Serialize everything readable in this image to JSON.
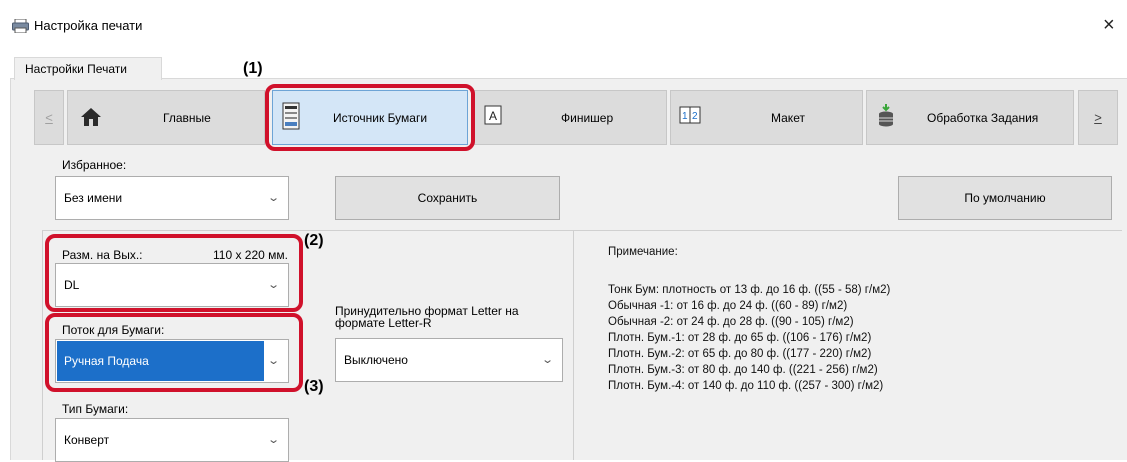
{
  "window": {
    "title": "Настройка печати",
    "close_glyph": "×"
  },
  "tab": {
    "label": "Настройки Печати"
  },
  "toolbar": {
    "prev": "<",
    "next": ">",
    "items": [
      {
        "label": "Главные",
        "icon": "home-icon"
      },
      {
        "label": "Источник Бумаги",
        "icon": "paper-tray-icon"
      },
      {
        "label": "Финишер",
        "icon": "finisher-icon"
      },
      {
        "label": "Макет",
        "icon": "layout-icon"
      },
      {
        "label": "Обработка Задания",
        "icon": "job-handling-icon"
      }
    ]
  },
  "favorites": {
    "label": "Избранное:",
    "value": "Без имени",
    "save_label": "Сохранить",
    "default_label": "По умолчанию"
  },
  "output_size": {
    "label": "Разм. на Вых.:",
    "dimensions": "110 x 220 мм.",
    "value": "DL"
  },
  "paper_tray": {
    "label": "Поток для Бумаги:",
    "value": "Ручная Подача"
  },
  "paper_type": {
    "label": "Тип Бумаги:",
    "value": "Конверт"
  },
  "force_letter": {
    "label": "Принудительно формат Letter на формате Letter-R",
    "value": "Выключено"
  },
  "notes": {
    "title": "Примечание:",
    "lines": [
      "Тонк Бум: плотность от 13 ф. до 16 ф. ((55 - 58) г/м2)",
      "Обычная -1: от 16 ф. до 24 ф. ((60 - 89) г/м2)",
      "Обычная -2: от 24 ф. до 28 ф. ((90 - 105) г/м2)",
      "Плотн. Бум.-1: от 28 ф. до 65 ф. ((106 - 176) г/м2)",
      "Плотн. Бум.-2: от 65 ф. до 80 ф. ((177 - 220) г/м2)",
      "Плотн. Бум.-3: от 80 ф. до 140 ф. ((221 - 256) г/м2)",
      "Плотн. Бум.-4: от 140 ф. до 110 ф. ((257 - 300) г/м2)"
    ]
  },
  "callouts": {
    "c1": "(1)",
    "c2": "(2)",
    "c3": "(3)"
  },
  "colors": {
    "callout": "#d0112b",
    "selected_blue": "#1c6fc9",
    "toolbar_selected": "#d4e6f7"
  }
}
